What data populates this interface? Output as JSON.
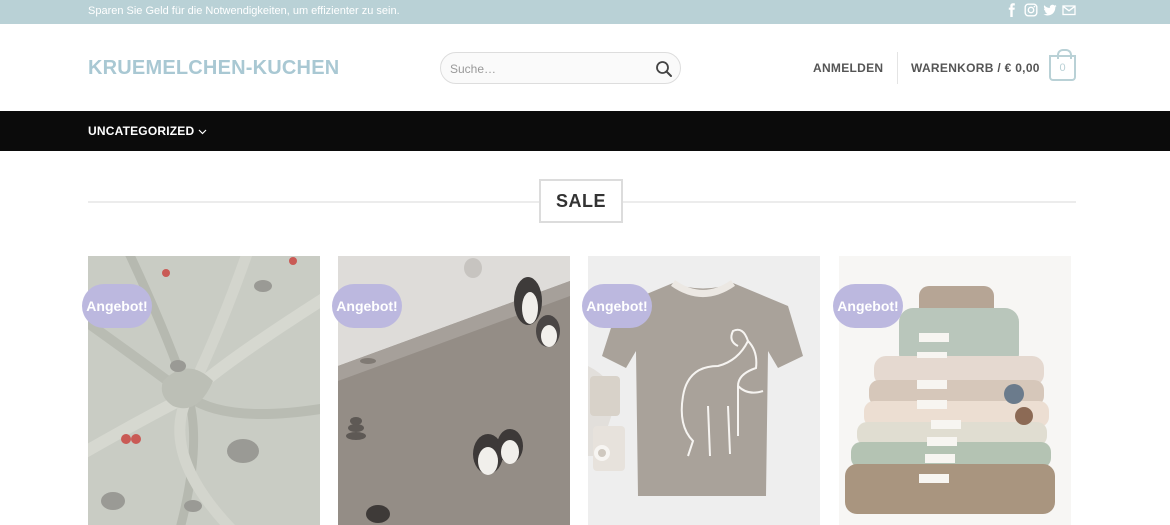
{
  "topbar": {
    "message": "Sparen Sie Geld für die Notwendigkeiten, um effizienter zu sein.",
    "socials": [
      "facebook-icon",
      "instagram-icon",
      "twitter-icon",
      "email-icon"
    ]
  },
  "header": {
    "logo": "KRUEMELCHEN-KUCHEN",
    "search_placeholder": "Suche…",
    "login_label": "ANMELDEN",
    "cart_label": "WARENKORB / € 0,00",
    "cart_count": "0"
  },
  "nav": {
    "items": [
      {
        "label": "UNCATEGORIZED"
      }
    ]
  },
  "section": {
    "title": "SALE"
  },
  "products": [
    {
      "badge": "Angebot!"
    },
    {
      "badge": "Angebot!"
    },
    {
      "badge": "Angebot!"
    },
    {
      "badge": "Angebot!"
    }
  ],
  "colors": {
    "topbar": "#b9d1d6",
    "logo": "#a9c8d3",
    "nav": "#0b0b0b",
    "badge": "#bcb8df"
  }
}
